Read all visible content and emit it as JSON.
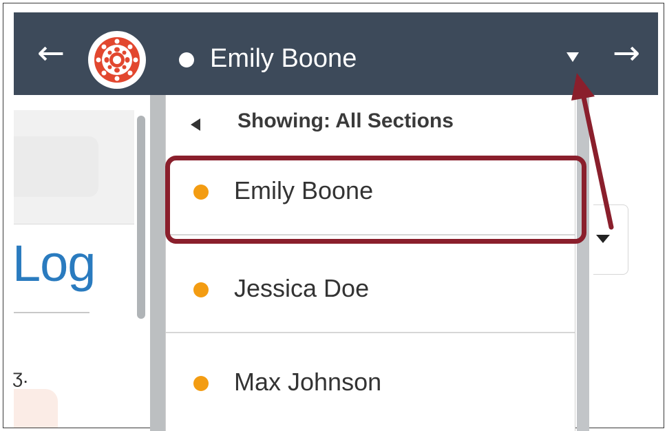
{
  "topbar": {
    "prev_arrow": "←",
    "next_arrow": "→",
    "logo_icon": "canvas-logo-icon",
    "current_student": "Emily Boone"
  },
  "page": {
    "heading_fragment": "Log",
    "text_fragment": "ʒ."
  },
  "student_menu": {
    "header": "Showing: All Sections",
    "back_icon": "triangle-left-icon",
    "students": [
      {
        "name": "Emily Boone",
        "highlighted": true
      },
      {
        "name": "Jessica Doe",
        "highlighted": false
      },
      {
        "name": "Max Johnson",
        "highlighted": false
      }
    ]
  },
  "colors": {
    "topbar_bg": "#3d4a5a",
    "logo_red": "#e2472f",
    "student_dot": "#f39c12",
    "highlight_border": "#8a1f2c",
    "annotation_arrow": "#8a1f2c",
    "heading_blue": "#2a7bbf"
  }
}
